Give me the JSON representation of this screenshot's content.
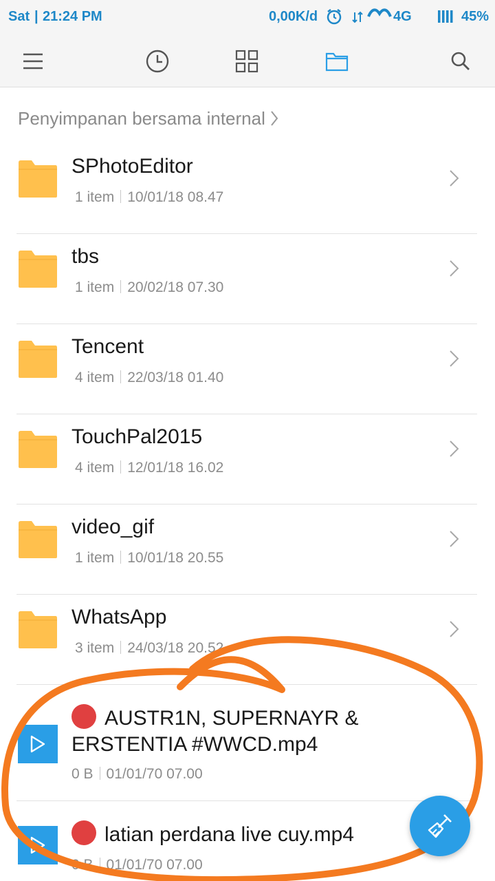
{
  "status_bar": {
    "day": "Sat",
    "time": "21:24 PM",
    "speed": "0,00K/d",
    "network": "4G",
    "battery": "45%"
  },
  "toolbar": {
    "icons": [
      "menu-icon",
      "clock-icon",
      "grid-icon",
      "folder-icon",
      "search-icon"
    ],
    "active_color": "#2a9ee6"
  },
  "breadcrumb": {
    "path": "Penyimpanan bersama internal"
  },
  "folders": [
    {
      "name": "SPhotoEditor",
      "count": "1 item",
      "date": "10/01/18 08.47"
    },
    {
      "name": "tbs",
      "count": "1 item",
      "date": "20/02/18 07.30"
    },
    {
      "name": "Tencent",
      "count": "4 item",
      "date": "22/03/18 01.40"
    },
    {
      "name": "TouchPal2015",
      "count": "4 item",
      "date": "12/01/18 16.02"
    },
    {
      "name": "video_gif",
      "count": "1 item",
      "date": "10/01/18 20.55"
    },
    {
      "name": "WhatsApp",
      "count": "3 item",
      "date": "24/03/18 20.52"
    }
  ],
  "files": [
    {
      "name": "AUSTR1N, SUPERNAYR & ERSTENTIA #WWCD.mp4",
      "size": "0 B",
      "date": "01/01/70 07.00"
    },
    {
      "name": "latian perdana live cuy.mp4",
      "size": "0 B",
      "date": "01/01/70 07.00"
    }
  ],
  "colors": {
    "accent": "#2a9ee6",
    "folder": "#ffc04d",
    "record_dot": "#e04040",
    "annotation": "#f47a20"
  }
}
